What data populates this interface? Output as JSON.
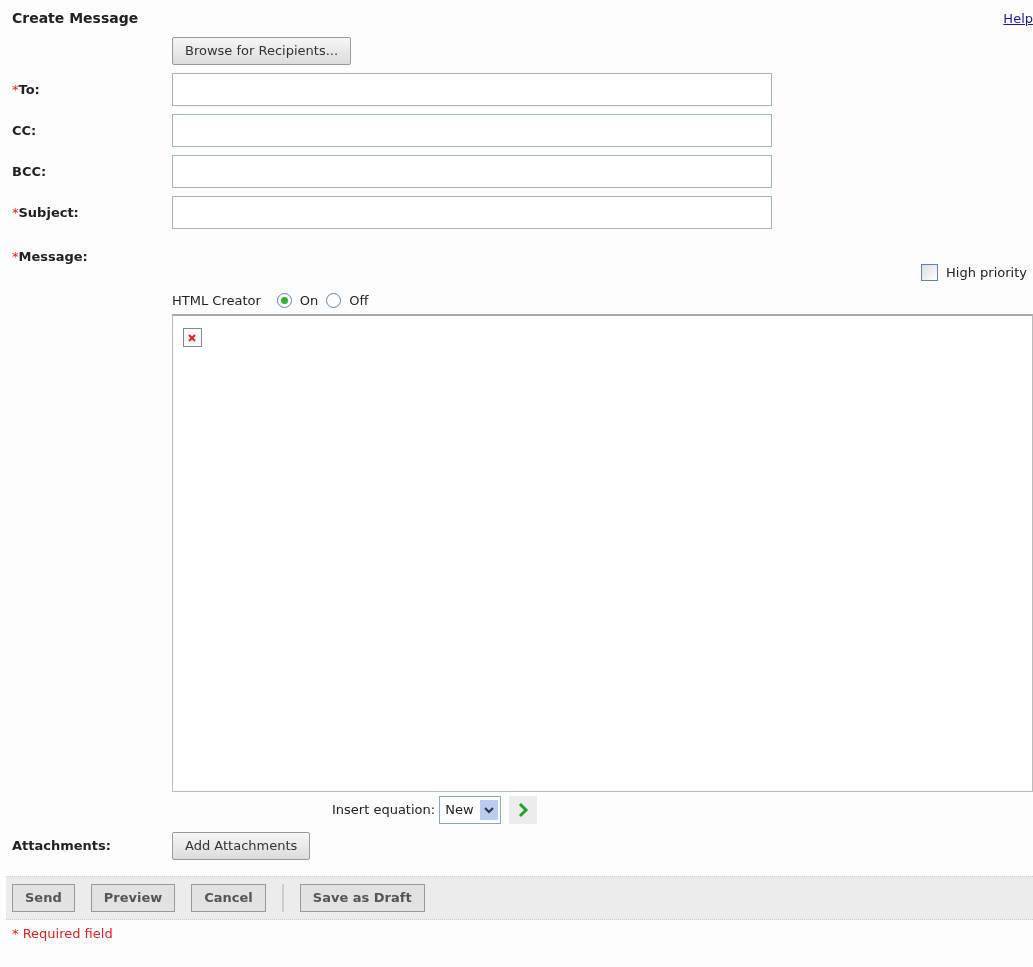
{
  "title": "Create Message",
  "help_link": "Help",
  "browse_button": "Browse for Recipients...",
  "fields": [
    {
      "label": "To:",
      "required_mark": "*"
    },
    {
      "label": "CC:"
    },
    {
      "label": "BCC:"
    },
    {
      "label": "Subject:",
      "required_mark": "*"
    }
  ],
  "message": {
    "label": "Message:",
    "required_mark": "*"
  },
  "high_priority": {
    "label": "High priority",
    "checked": false
  },
  "html_creator": {
    "label": "HTML Creator",
    "options": [
      {
        "label": "On",
        "selected": true
      },
      {
        "label": "Off",
        "selected": false
      }
    ]
  },
  "insert_equation": {
    "label": "Insert equation:",
    "value": "New"
  },
  "attachments": {
    "label": "Attachments:",
    "button": "Add Attachments"
  },
  "actions": [
    {
      "label": "Send",
      "separator_before": false
    },
    {
      "label": "Preview",
      "separator_before": false
    },
    {
      "label": "Cancel",
      "separator_before": false
    },
    {
      "label": "Save as Draft",
      "separator_before": true
    }
  ],
  "required_note": "* Required field"
}
